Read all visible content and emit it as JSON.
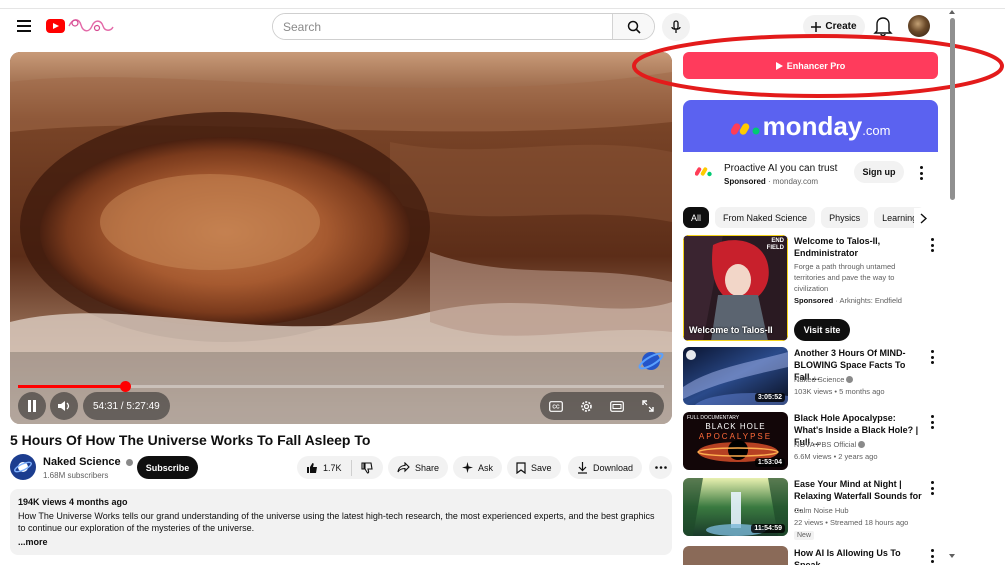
{
  "header": {
    "search_placeholder": "Search",
    "create_label": "Create"
  },
  "player": {
    "time_display": "54:31 / 5:27:49",
    "progress_fraction": 0.166
  },
  "video": {
    "title": "5 Hours Of How The Universe Works To Fall Asleep To",
    "channel_name": "Naked Science",
    "subscribers": "1.68M subscribers",
    "subscribe_label": "Subscribe",
    "likes": "1.7K",
    "share_label": "Share",
    "ask_label": "Ask",
    "save_label": "Save",
    "download_label": "Download",
    "description": {
      "stats": "194K views  4 months ago",
      "text": "How The Universe Works tells our grand understanding of the universe using the latest high-tech research, the most experienced experts, and the best graphics to continue our exploration of the mysteries of the universe.",
      "more": "...more"
    }
  },
  "sidebar": {
    "enhancer_label": "Enhancer Pro",
    "ad": {
      "brand_word": "monday",
      "brand_suffix": ".com",
      "title": "Proactive AI you can trust",
      "sponsored": "Sponsored",
      "domain": "monday.com",
      "signup_label": "Sign up"
    },
    "chips": [
      "All",
      "From Naked Science",
      "Physics",
      "Learning"
    ],
    "recommendations": [
      {
        "title": "Welcome to Talos-II, Endministrator",
        "desc": "Forge a path through untamed territories and pave the way to civilization",
        "sponsored": "Sponsored",
        "advertiser": "Arknights: Endfield",
        "thumb_caption": "Welcome to Talos-II",
        "thumb_badge": "END FIELD",
        "cta": "Visit site"
      },
      {
        "title": "Another 3 Hours Of MIND-BLOWING Space Facts To Fall ...",
        "channel": "Naked Science",
        "meta": "103K views • 5 months ago",
        "duration": "3:05:52"
      },
      {
        "title": "Black Hole Apocalypse: What's Inside a Black Hole? | Full ...",
        "channel": "NOVA PBS Official",
        "meta": "6.6M views • 2 years ago",
        "duration": "1:53:04",
        "thumb_caption": "BLACK HOLE",
        "thumb_caption2": "APOCALYPSE",
        "thumb_top": "FULL DOCUMENTARY"
      },
      {
        "title": "Ease Your Mind at Night | Relaxing Waterfall Sounds for ...",
        "channel": "Calm Noise Hub",
        "meta": "22 views • Streamed 18 hours ago",
        "badge": "New",
        "duration": "11:54:59"
      },
      {
        "title": "How AI Is Allowing Us To Speak"
      }
    ]
  },
  "colors": {
    "youtube_red": "#ff0000",
    "enhancer_pink": "#ff3b5c",
    "monday_blue": "#5b62f0",
    "annotation_red": "#e31b1b"
  }
}
